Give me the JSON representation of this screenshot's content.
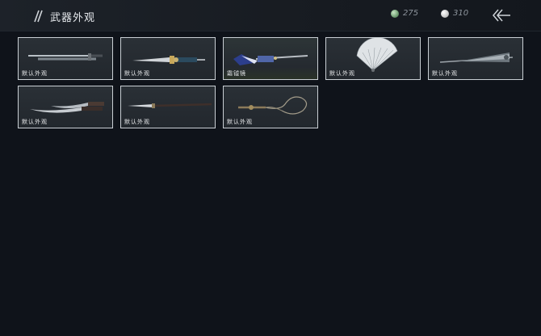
{
  "header": {
    "title": "武器外观",
    "currency_jade": "275",
    "currency_silver": "310"
  },
  "skins": [
    {
      "label": "默认外观",
      "icon": "sword-icon"
    },
    {
      "label": "默认外观",
      "icon": "dagger-icon"
    },
    {
      "label": "霜钺镜",
      "icon": "blue-blade-icon"
    },
    {
      "label": "默认外观",
      "icon": "fan-icon"
    },
    {
      "label": "默认外观",
      "icon": "umbrella-icon"
    },
    {
      "label": "默认外观",
      "icon": "twin-blades-icon"
    },
    {
      "label": "默认外观",
      "icon": "spear-icon"
    },
    {
      "label": "默认外观",
      "icon": "whip-icon"
    }
  ]
}
